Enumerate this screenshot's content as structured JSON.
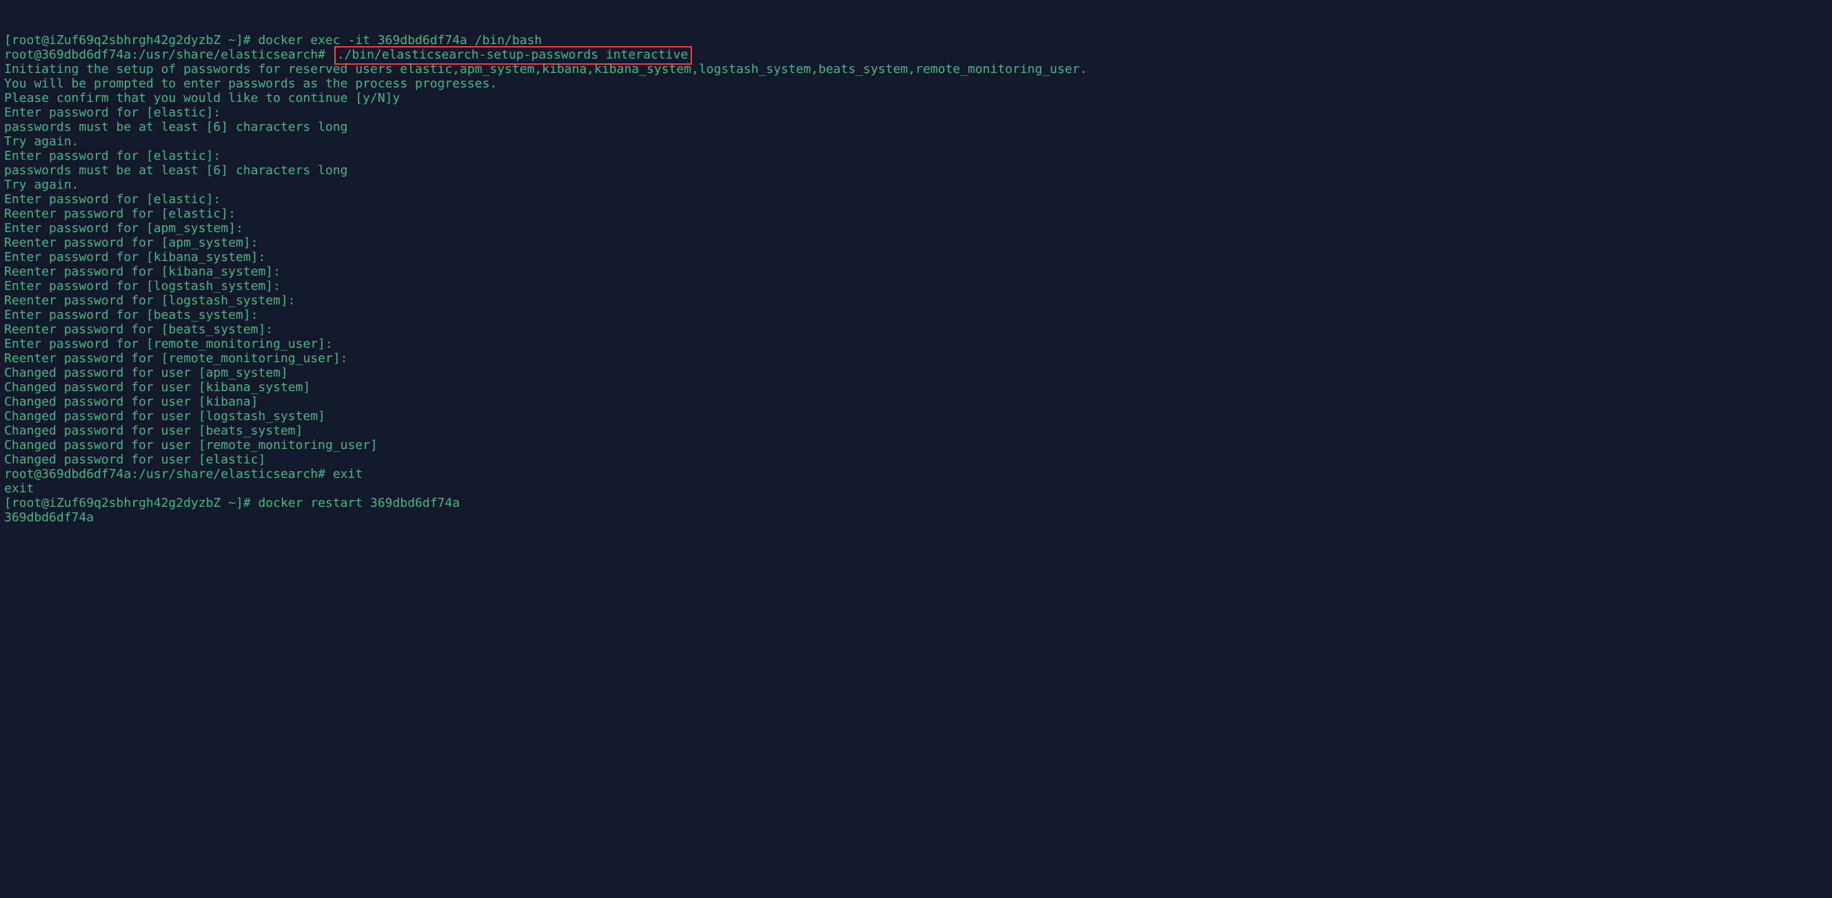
{
  "colors": {
    "bg": "#14182b",
    "text": "#3fb985",
    "highlight_border": "#ff3b3b"
  },
  "lines": [
    {
      "segments": [
        {
          "text": "[root@iZuf69q2sbhrgh42g2dyzbZ ~]# docker exec -it 369dbd6df74a /bin/bash"
        }
      ]
    },
    {
      "segments": [
        {
          "text": "root@369dbd6df74a:/usr/share/elasticsearch# "
        },
        {
          "text": "./bin/elasticsearch-setup-passwords interactive",
          "highlight": true
        }
      ]
    },
    {
      "segments": [
        {
          "text": "Initiating the setup of passwords for reserved users elastic,apm_system,kibana,kibana_system,logstash_system,beats_system,remote_monitoring_user."
        }
      ]
    },
    {
      "segments": [
        {
          "text": "You will be prompted to enter passwords as the process progresses."
        }
      ]
    },
    {
      "segments": [
        {
          "text": "Please confirm that you would like to continue [y/N]y"
        }
      ]
    },
    {
      "segments": [
        {
          "text": ""
        }
      ]
    },
    {
      "segments": [
        {
          "text": ""
        }
      ]
    },
    {
      "segments": [
        {
          "text": "Enter password for [elastic]:"
        }
      ]
    },
    {
      "segments": [
        {
          "text": "passwords must be at least [6] characters long"
        }
      ]
    },
    {
      "segments": [
        {
          "text": "Try again."
        }
      ]
    },
    {
      "segments": [
        {
          "text": "Enter password for [elastic]:"
        }
      ]
    },
    {
      "segments": [
        {
          "text": "passwords must be at least [6] characters long"
        }
      ]
    },
    {
      "segments": [
        {
          "text": "Try again."
        }
      ]
    },
    {
      "segments": [
        {
          "text": "Enter password for [elastic]:"
        }
      ]
    },
    {
      "segments": [
        {
          "text": "Reenter password for [elastic]:"
        }
      ]
    },
    {
      "segments": [
        {
          "text": "Enter password for [apm_system]:"
        }
      ]
    },
    {
      "segments": [
        {
          "text": "Reenter password for [apm_system]:"
        }
      ]
    },
    {
      "segments": [
        {
          "text": "Enter password for [kibana_system]:"
        }
      ]
    },
    {
      "segments": [
        {
          "text": "Reenter password for [kibana_system]:"
        }
      ]
    },
    {
      "segments": [
        {
          "text": "Enter password for [logstash_system]:"
        }
      ]
    },
    {
      "segments": [
        {
          "text": "Reenter password for [logstash_system]:"
        }
      ]
    },
    {
      "segments": [
        {
          "text": "Enter password for [beats_system]:"
        }
      ]
    },
    {
      "segments": [
        {
          "text": "Reenter password for [beats_system]:"
        }
      ]
    },
    {
      "segments": [
        {
          "text": "Enter password for [remote_monitoring_user]:"
        }
      ]
    },
    {
      "segments": [
        {
          "text": "Reenter password for [remote_monitoring_user]:"
        }
      ]
    },
    {
      "segments": [
        {
          "text": "Changed password for user [apm_system]"
        }
      ]
    },
    {
      "segments": [
        {
          "text": "Changed password for user [kibana_system]"
        }
      ]
    },
    {
      "segments": [
        {
          "text": "Changed password for user [kibana]"
        }
      ]
    },
    {
      "segments": [
        {
          "text": "Changed password for user [logstash_system]"
        }
      ]
    },
    {
      "segments": [
        {
          "text": "Changed password for user [beats_system]"
        }
      ]
    },
    {
      "segments": [
        {
          "text": "Changed password for user [remote_monitoring_user]"
        }
      ]
    },
    {
      "segments": [
        {
          "text": "Changed password for user [elastic]"
        }
      ]
    },
    {
      "segments": [
        {
          "text": "root@369dbd6df74a:/usr/share/elasticsearch# exit"
        }
      ]
    },
    {
      "segments": [
        {
          "text": "exit"
        }
      ]
    },
    {
      "segments": [
        {
          "text": "[root@iZuf69q2sbhrgh42g2dyzbZ ~]# docker restart 369dbd6df74a"
        }
      ]
    },
    {
      "segments": [
        {
          "text": "369dbd6df74a"
        }
      ]
    }
  ]
}
